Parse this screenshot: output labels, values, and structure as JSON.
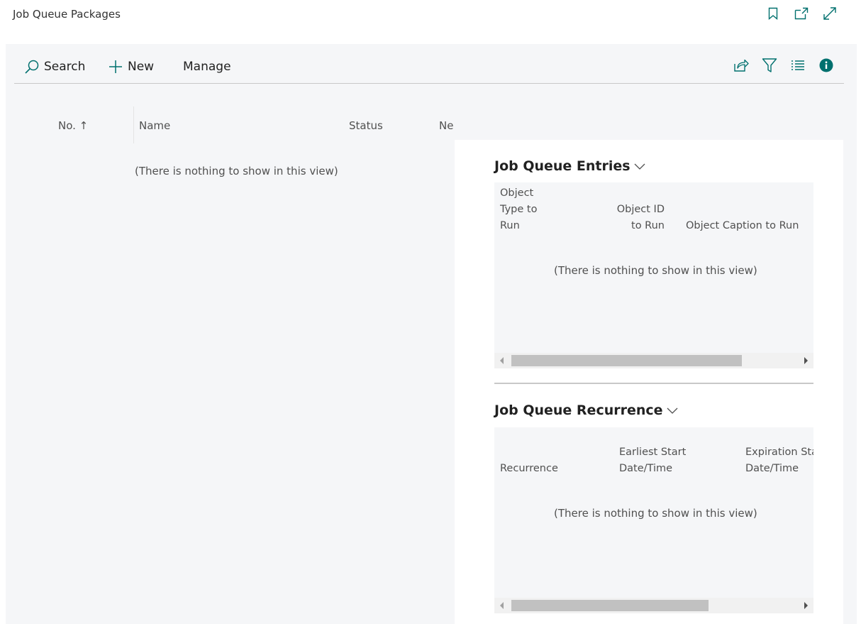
{
  "page": {
    "title": "Job Queue Packages"
  },
  "header_icons": [
    "bookmark-icon",
    "open-new-window-icon",
    "expand-icon"
  ],
  "action_bar": {
    "search_label": "Search",
    "new_label": "New",
    "manage_label": "Manage",
    "right_icons": [
      "share-icon",
      "filter-icon",
      "list-view-icon",
      "info-icon"
    ]
  },
  "list": {
    "columns": {
      "no": "No. ↑",
      "name": "Name",
      "status": "Status",
      "ne": "Ne"
    },
    "empty_text": "(There is nothing to show in this view)"
  },
  "factbox": {
    "entries": {
      "title": "Job Queue Entries",
      "col_object_type": [
        "Object",
        "Type to",
        "Run"
      ],
      "col_object_id": [
        "Object ID",
        "to Run"
      ],
      "col_object_caption": "Object Caption to Run",
      "empty_text": "(There is nothing to show in this view)"
    },
    "recurrence": {
      "title": "Job Queue Recurrence",
      "col_recurrence": "Recurrence",
      "col_earliest": [
        "Earliest Start",
        "Date/Time"
      ],
      "col_expiration": [
        "Expiration Sta",
        "Date/Time"
      ],
      "empty_text": "(There is nothing to show in this view)"
    }
  },
  "colors": {
    "accent": "#00706e",
    "content_bg": "#f5f6f8",
    "text": "#212121",
    "muted_text": "#505050"
  }
}
